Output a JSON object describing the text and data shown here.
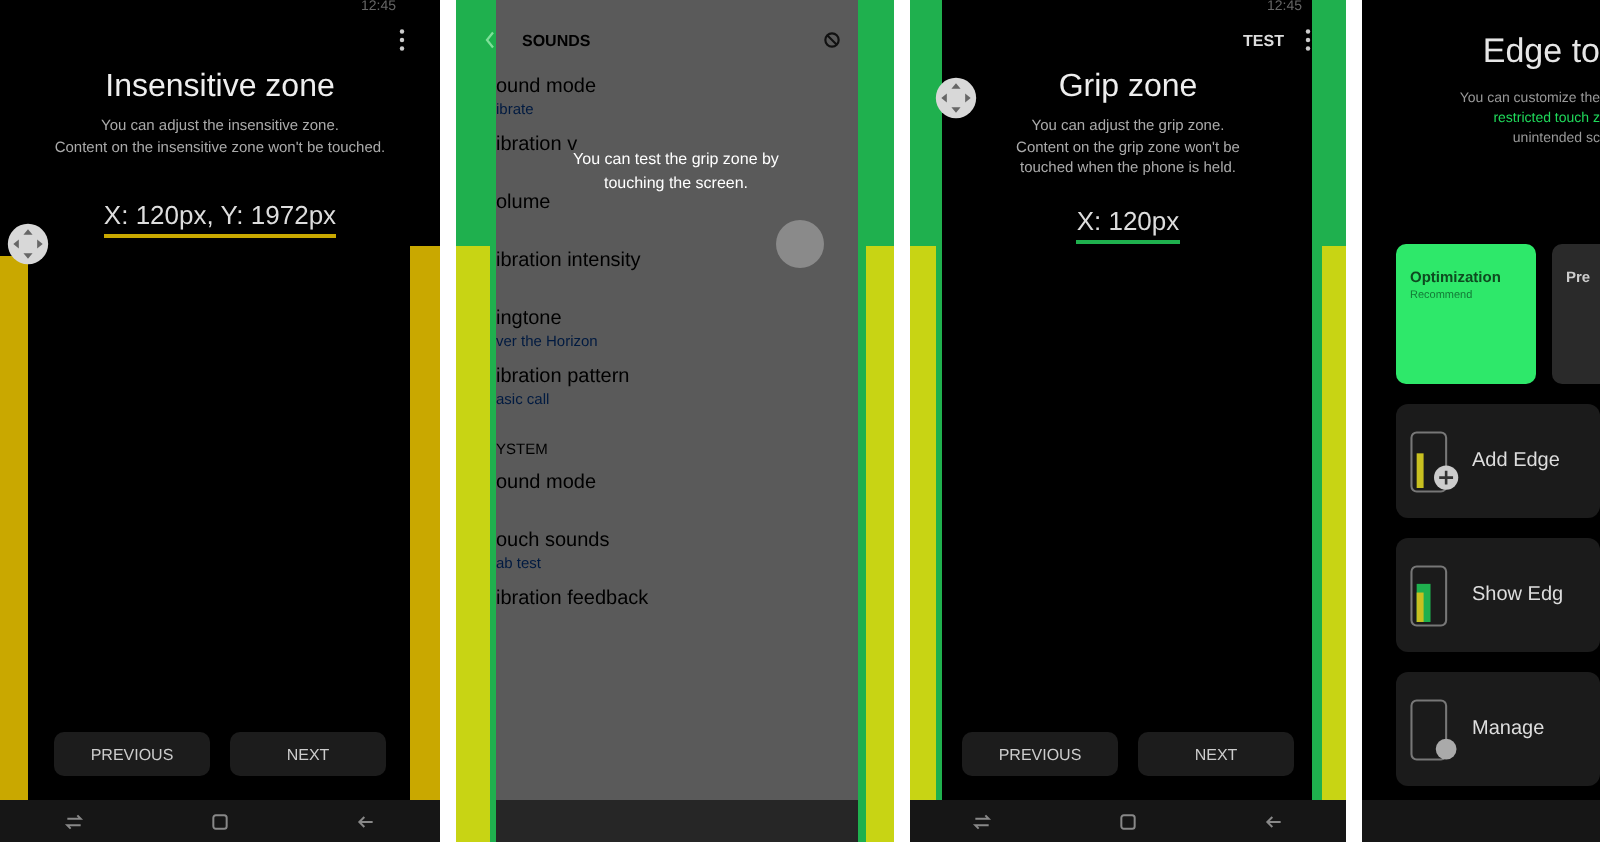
{
  "screens": [
    {
      "kind": "zone",
      "status_time": "12:45",
      "menu": true,
      "title": "Insensitive zone",
      "description": [
        "You can adjust the insensitive zone.",
        "Content on the insensitive zone won't be touched."
      ],
      "value": "X: 120px, Y: 1972px",
      "zones": [
        {
          "kind": "insensitive",
          "color": "#c9a800"
        }
      ],
      "buttons": [
        "PREVIOUS",
        "NEXT"
      ]
    },
    {
      "kind": "test",
      "header": "SOUNDS",
      "message": "You can test the grip zone by touching the screen.",
      "zones": [
        {
          "kind": "grip",
          "color": "#1fb04e"
        },
        {
          "kind": "insensitive",
          "color": "#c8d414"
        }
      ],
      "items": [
        {
          "kind": "item",
          "title": "ound mode",
          "subtitle": "ibrate"
        },
        {
          "kind": "item",
          "title": "ibration v"
        },
        {
          "kind": "item",
          "title": "olume"
        },
        {
          "kind": "item",
          "title": "ibration intensity"
        },
        {
          "kind": "item",
          "title": "ingtone",
          "subtitle": "ver the Horizon"
        },
        {
          "kind": "item",
          "title": "ibration pattern",
          "subtitle": "asic call"
        },
        {
          "kind": "section",
          "title": "YSTEM"
        },
        {
          "kind": "item",
          "title": "ound mode"
        },
        {
          "kind": "item",
          "title": "ouch sounds",
          "subtitle": "ab test"
        },
        {
          "kind": "item",
          "title": "ibration feedback"
        }
      ]
    },
    {
      "kind": "zone",
      "status_time": "12:45",
      "action": "TEST",
      "menu": true,
      "title": "Grip zone",
      "description": [
        "You can adjust the grip zone.",
        "Content on the grip zone won't be",
        "touched when the phone is held."
      ],
      "value": "X: 120px",
      "zones": [
        {
          "kind": "grip",
          "color": "#1fb04e"
        },
        {
          "kind": "insensitive",
          "color": "#c8d414"
        }
      ],
      "buttons": [
        "PREVIOUS",
        "NEXT"
      ]
    },
    {
      "kind": "edge",
      "title": "Edge to",
      "description": [
        {
          "text": "You can customize the",
          "highlight": false
        },
        {
          "text": "restricted touch z",
          "highlight": true
        },
        {
          "text": "unintended sc",
          "highlight": false
        }
      ],
      "modes": [
        {
          "title": "Optimization",
          "subtitle": "Recommend",
          "selected": true
        },
        {
          "title": "Pre",
          "selected": false
        }
      ],
      "options": [
        {
          "label": "Add Edge",
          "kind": "add"
        },
        {
          "label": "Show Edg",
          "kind": "show"
        },
        {
          "label": "Manage",
          "kind": "manage"
        }
      ]
    }
  ]
}
